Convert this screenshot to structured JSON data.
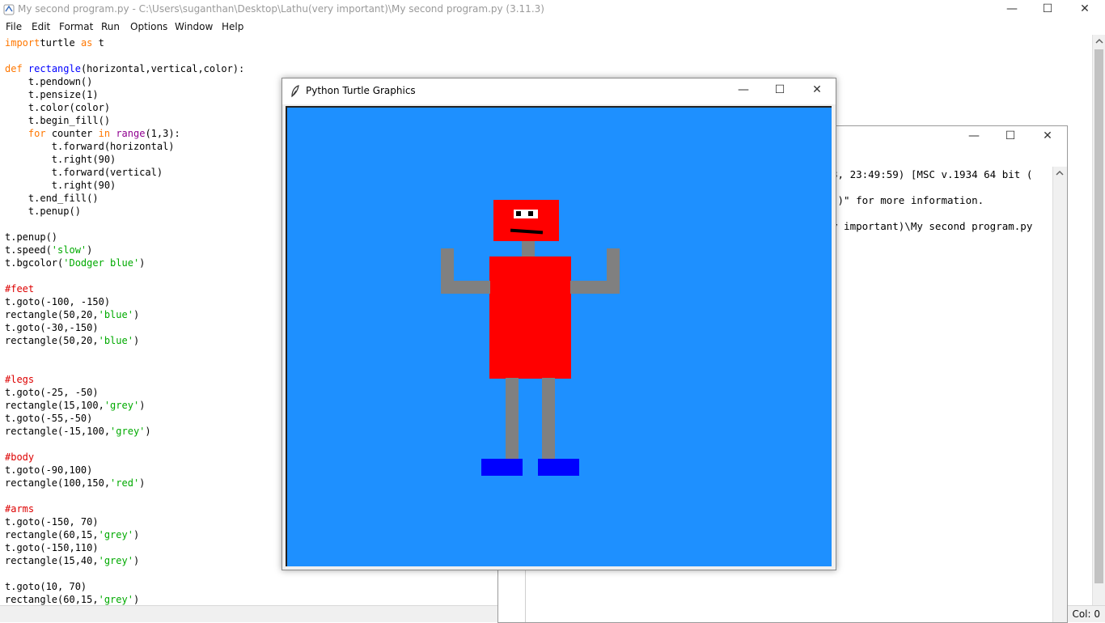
{
  "idle": {
    "title": "My second program.py - C:\\Users\\suganthan\\Desktop\\Lathu(very important)\\My second program.py (3.11.3)",
    "menu": [
      "File",
      "Edit",
      "Format",
      "Run",
      "Options",
      "Window",
      "Help"
    ],
    "status": "Col: 0"
  },
  "turtle_window": {
    "title": "Python Turtle Graphics"
  },
  "shell": {
    "lines": [
      "3, 23:49:59) [MSC v.1934 64 bit (",
      "()\" for more information.",
      "y important)\\My second program.py"
    ]
  },
  "window_controls": {
    "minimize": "—",
    "maximize": "☐",
    "close": "✕"
  },
  "colors": {
    "canvas_bg": "#1e90ff",
    "red": "#ff0000",
    "grey": "#808080",
    "blue": "#0000ff",
    "keyword": "#ff7700",
    "string": "#00aa00",
    "comment": "#dd0000",
    "builtin": "#900090",
    "defname": "#0000ff"
  },
  "code": [
    [
      [
        "kw",
        "import"
      ],
      [
        "",
        "turtle "
      ],
      [
        "kw",
        "as"
      ],
      [
        "",
        " t"
      ]
    ],
    [],
    [
      [
        "kw",
        "def"
      ],
      [
        "",
        " "
      ],
      [
        "fn",
        "rectangle"
      ],
      [
        "",
        "(horizontal,vertical,color):"
      ]
    ],
    [
      [
        "",
        "    t.pendown()"
      ]
    ],
    [
      [
        "",
        "    t.pensize(1)"
      ]
    ],
    [
      [
        "",
        "    t.color(color)"
      ]
    ],
    [
      [
        "",
        "    t.begin_fill()"
      ]
    ],
    [
      [
        "",
        "    "
      ],
      [
        "kw",
        "for"
      ],
      [
        "",
        " counter "
      ],
      [
        "kw",
        "in"
      ],
      [
        "",
        " "
      ],
      [
        "bi",
        "range"
      ],
      [
        "",
        "(1,3):"
      ]
    ],
    [
      [
        "",
        "        t.forward(horizontal)"
      ]
    ],
    [
      [
        "",
        "        t.right(90)"
      ]
    ],
    [
      [
        "",
        "        t.forward(vertical)"
      ]
    ],
    [
      [
        "",
        "        t.right(90)"
      ]
    ],
    [
      [
        "",
        "    t.end_fill()"
      ]
    ],
    [
      [
        "",
        "    t.penup()"
      ]
    ],
    [],
    [
      [
        "",
        "t.penup()"
      ]
    ],
    [
      [
        "",
        "t.speed("
      ],
      [
        "str",
        "'slow'"
      ],
      [
        "",
        ")"
      ]
    ],
    [
      [
        "",
        "t.bgcolor("
      ],
      [
        "str",
        "'Dodger blue'"
      ],
      [
        "",
        ")"
      ]
    ],
    [],
    [
      [
        "cm",
        "#feet"
      ]
    ],
    [
      [
        "",
        "t.goto(-100, -150)"
      ]
    ],
    [
      [
        "",
        "rectangle(50,20,"
      ],
      [
        "str",
        "'blue'"
      ],
      [
        "",
        ")"
      ]
    ],
    [
      [
        "",
        "t.goto(-30,-150)"
      ]
    ],
    [
      [
        "",
        "rectangle(50,20,"
      ],
      [
        "str",
        "'blue'"
      ],
      [
        "",
        ")"
      ]
    ],
    [],
    [],
    [
      [
        "cm",
        "#legs"
      ]
    ],
    [
      [
        "",
        "t.goto(-25, -50)"
      ]
    ],
    [
      [
        "",
        "rectangle(15,100,"
      ],
      [
        "str",
        "'grey'"
      ],
      [
        "",
        ")"
      ]
    ],
    [
      [
        "",
        "t.goto(-55,-50)"
      ]
    ],
    [
      [
        "",
        "rectangle(-15,100,"
      ],
      [
        "str",
        "'grey'"
      ],
      [
        "",
        ")"
      ]
    ],
    [],
    [
      [
        "cm",
        "#body"
      ]
    ],
    [
      [
        "",
        "t.goto(-90,100)"
      ]
    ],
    [
      [
        "",
        "rectangle(100,150,"
      ],
      [
        "str",
        "'red'"
      ],
      [
        "",
        ")"
      ]
    ],
    [],
    [
      [
        "cm",
        "#arms"
      ]
    ],
    [
      [
        "",
        "t.goto(-150, 70)"
      ]
    ],
    [
      [
        "",
        "rectangle(60,15,"
      ],
      [
        "str",
        "'grey'"
      ],
      [
        "",
        ")"
      ]
    ],
    [
      [
        "",
        "t.goto(-150,110)"
      ]
    ],
    [
      [
        "",
        "rectangle(15,40,"
      ],
      [
        "str",
        "'grey'"
      ],
      [
        "",
        ")"
      ]
    ],
    [],
    [
      [
        "",
        "t.goto(10, 70)"
      ]
    ],
    [
      [
        "",
        "rectangle(60,15,"
      ],
      [
        "str",
        "'grey'"
      ],
      [
        "",
        ")"
      ]
    ]
  ]
}
